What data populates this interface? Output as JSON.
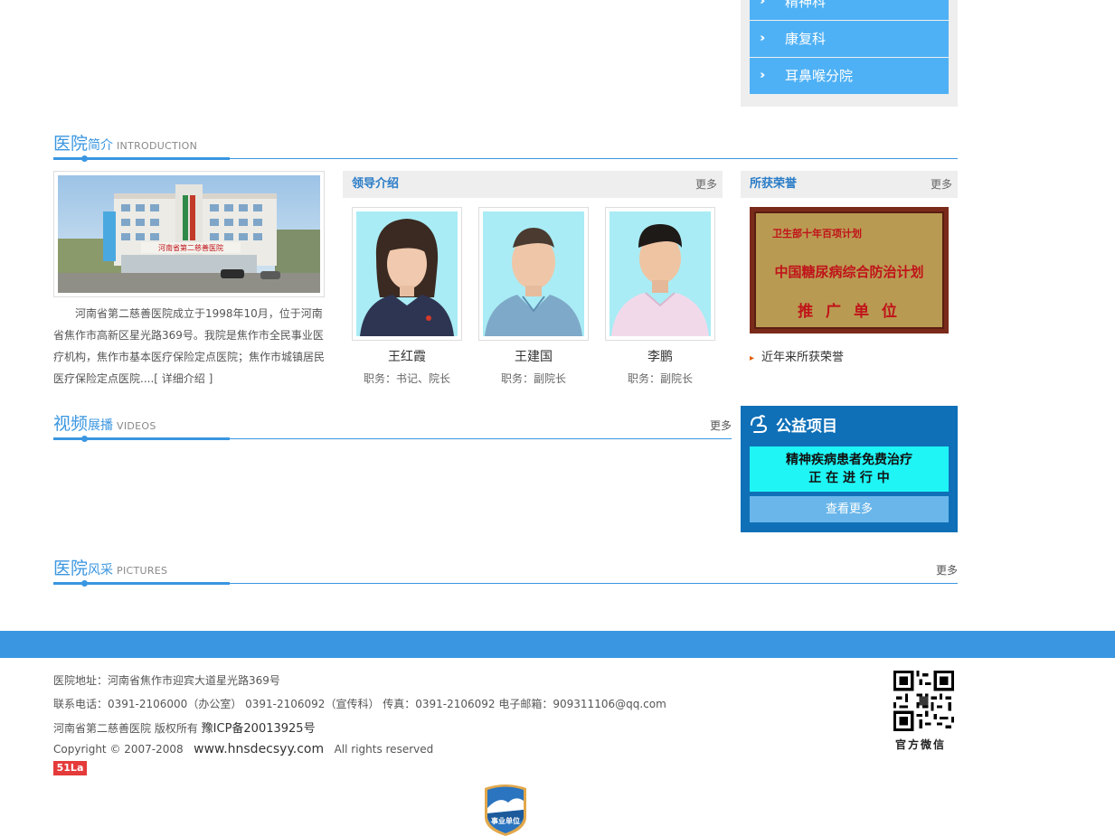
{
  "departments": [
    {
      "label": "精神科"
    },
    {
      "label": "康复科"
    },
    {
      "label": "耳鼻喉分院"
    }
  ],
  "intro": {
    "title_big": "医院",
    "title_small": "简介",
    "title_en": "INTRODUCTION",
    "building_sign": "河南省第二慈善医院",
    "text": "河南省第二慈善医院成立于1998年10月，位于河南省焦作市高新区星光路369号。我院是焦作市全民事业医疗机构，焦作市基本医疗保险定点医院；焦作市城镇居民医疗保险定点医院....",
    "detail_link": "[ 详细介绍 ]"
  },
  "leaders": {
    "heading": "领导介绍",
    "more": "更多",
    "people": [
      {
        "name": "王红霞",
        "role": "职务：书记、院长"
      },
      {
        "name": "王建国",
        "role": "职务：副院长"
      },
      {
        "name": "李鹏",
        "role": "职务：副院长"
      }
    ]
  },
  "honors": {
    "heading": "所获荣誉",
    "more": "更多",
    "plaque_line1": "卫生部十年百项计划",
    "plaque_line2": "中国糖尿病综合防治计划",
    "plaque_line3": "推 广 单 位",
    "link": "近年来所获荣誉"
  },
  "videos": {
    "title_big": "视频",
    "title_small": "展播",
    "title_en": "VIDEOS",
    "more": "更多"
  },
  "charity": {
    "title": "公益项目",
    "banner_line1": "精神疾病患者免费治疗",
    "banner_line2": "正 在 进 行 中",
    "button": "查看更多"
  },
  "pictures": {
    "title_big": "医院",
    "title_small": "风采",
    "title_en": "PICTURES",
    "more": "更多"
  },
  "footer": {
    "address": "医院地址：河南省焦作市迎宾大道星光路369号",
    "contact": "联系电话：0391-2106000（办公室） 0391-2106092（宣传科） 传真：0391-2106092 电子邮箱：909311106@qq.com",
    "copyright_owner": "河南省第二慈善医院 版权所有",
    "icp": "豫ICP备20013925号",
    "copyright_prefix": "Copyright © 2007-2008",
    "domain": "www.hnsdecsyy.com",
    "rights": "All rights reserved",
    "stat_badge": "51La",
    "qr_caption": "官方微信",
    "institution_badge": "事业单位"
  },
  "colors": {
    "accent": "#3a96e0",
    "dept_item": "#4fb1f5",
    "charity_bg": "#0f70b8",
    "charity_banner": "#1ff5f5"
  }
}
